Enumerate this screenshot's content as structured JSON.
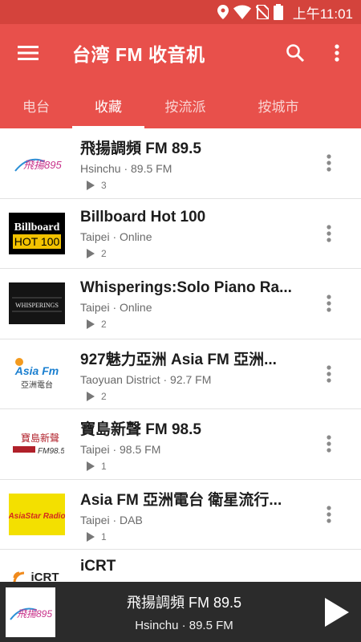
{
  "status_bar": {
    "time": "上午11:01"
  },
  "app_bar": {
    "title": "台湾 FM 收音机"
  },
  "tabs": [
    {
      "label": "电台",
      "active": false
    },
    {
      "label": "收藏",
      "active": true
    },
    {
      "label": "按流派",
      "active": false
    },
    {
      "label": "按城市",
      "active": false
    }
  ],
  "stations": [
    {
      "name": "飛揚調頻 FM 89.5",
      "location": "Hsinchu · 89.5 FM",
      "plays": "3",
      "logo": {
        "text": "飛揚895"
      }
    },
    {
      "name": "Billboard Hot 100",
      "location": "Taipei · Online",
      "plays": "2",
      "logo": {
        "line1": "Billboard",
        "line2": "HOT 100"
      }
    },
    {
      "name": "Whisperings:Solo Piano Ra...",
      "location": "Taipei · Online",
      "plays": "2",
      "logo": {
        "text": "WHISPERINGS"
      }
    },
    {
      "name": "927魅力亞洲 Asia FM 亞洲...",
      "location": "Taoyuan District · 92.7 FM",
      "plays": "2",
      "logo": {
        "line1": "Asia Fm",
        "line2": "亞洲電台"
      }
    },
    {
      "name": "寶島新聲 FM 98.5",
      "location": "Taipei · 98.5 FM",
      "plays": "1",
      "logo": {
        "line1": "寶島新聲",
        "line2": "FM98.5"
      }
    },
    {
      "name": "Asia FM 亞洲電台 衛星流行...",
      "location": "Taipei · DAB",
      "plays": "1",
      "logo": {
        "text": "AsiaStar Radio"
      }
    },
    {
      "name": "iCRT",
      "location": "",
      "plays": "",
      "logo": {
        "text": "iCRT"
      }
    }
  ],
  "player": {
    "title": "飛揚調頻 FM 89.5",
    "subtitle": "Hsinchu · 89.5 FM",
    "logo_text": "飛揚895"
  },
  "colors": {
    "primary": "#e8504b",
    "status_bar": "#d4433c",
    "player_bg": "#2b2b2b"
  }
}
